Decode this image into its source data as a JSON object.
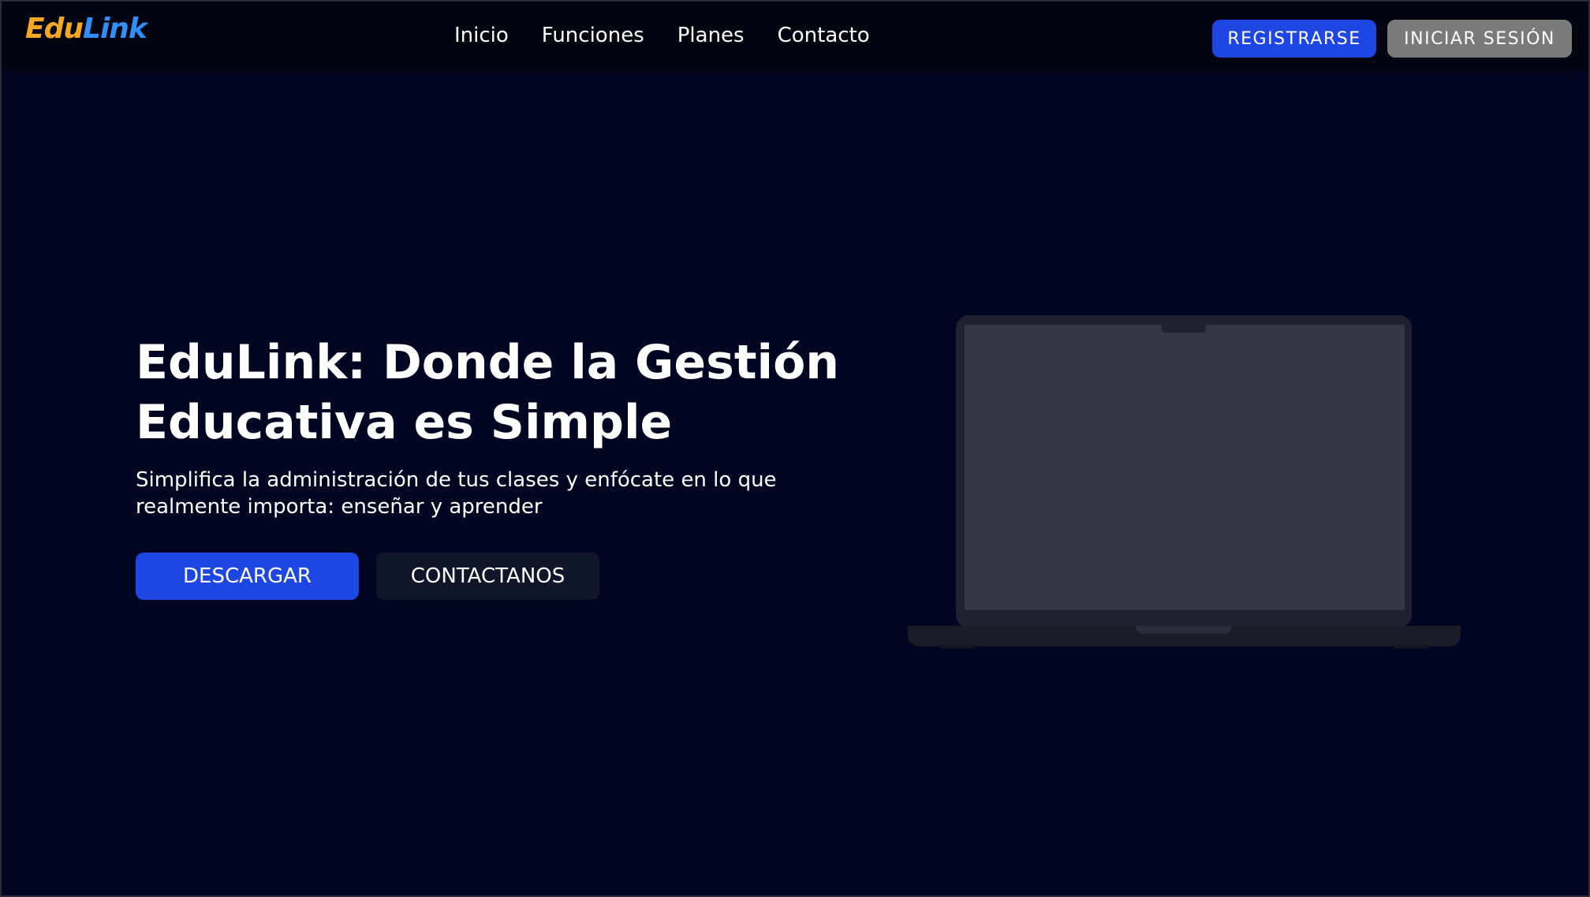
{
  "brand": {
    "logo_part1": "Edu",
    "logo_part2": "Link",
    "logo_color1": "#f5a623",
    "logo_color2": "#2f8ff7"
  },
  "nav": {
    "items": [
      {
        "label": "Inicio"
      },
      {
        "label": "Funciones"
      },
      {
        "label": "Planes"
      },
      {
        "label": "Contacto"
      }
    ],
    "register_label": "REGISTRARSE",
    "login_label": "INICIAR SESIÓN"
  },
  "hero": {
    "title": "EduLink: Donde la Gestión Educativa es Simple",
    "subtitle": "Simplifica la administración de tus clases y enfócate en lo que realmente importa: enseñar y aprender",
    "download_label": "DESCARGAR",
    "contact_label": "CONTACTANOS"
  },
  "illustration": {
    "icon": "laptop-icon"
  },
  "colors": {
    "background": "#000622",
    "primary": "#1e46e3",
    "secondary_button": "#7a7a7a"
  }
}
